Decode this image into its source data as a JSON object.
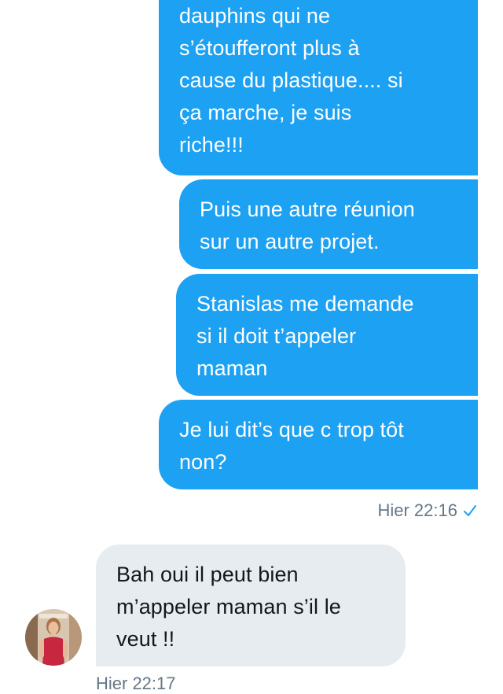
{
  "conversation": {
    "messages": [
      {
        "direction": "sent",
        "text": "dauphins qui ne\ns’étoufferont plus à\ncause du plastique.... si\nça marche, je suis\nriche!!!"
      },
      {
        "direction": "sent",
        "text": "Puis une autre réunion\nsur un autre projet."
      },
      {
        "direction": "sent",
        "text": "Stanislas me demande\nsi il doit t’appeler\nmaman"
      },
      {
        "direction": "sent",
        "text": "Je lui dit’s que c trop tôt\nnon?"
      },
      {
        "direction": "received",
        "text": "Bah oui il peut bien\nm’appeler maman s’il le\nveut !!"
      }
    ],
    "sent_meta": {
      "timestamp": "Hier 22:16",
      "status_icon": "read-check-icon"
    },
    "received_meta_partial": "Hier 22:17"
  },
  "colors": {
    "sent_bubble": "#1da1f2",
    "received_bubble": "#e6ecf0",
    "meta_text": "#657786"
  }
}
